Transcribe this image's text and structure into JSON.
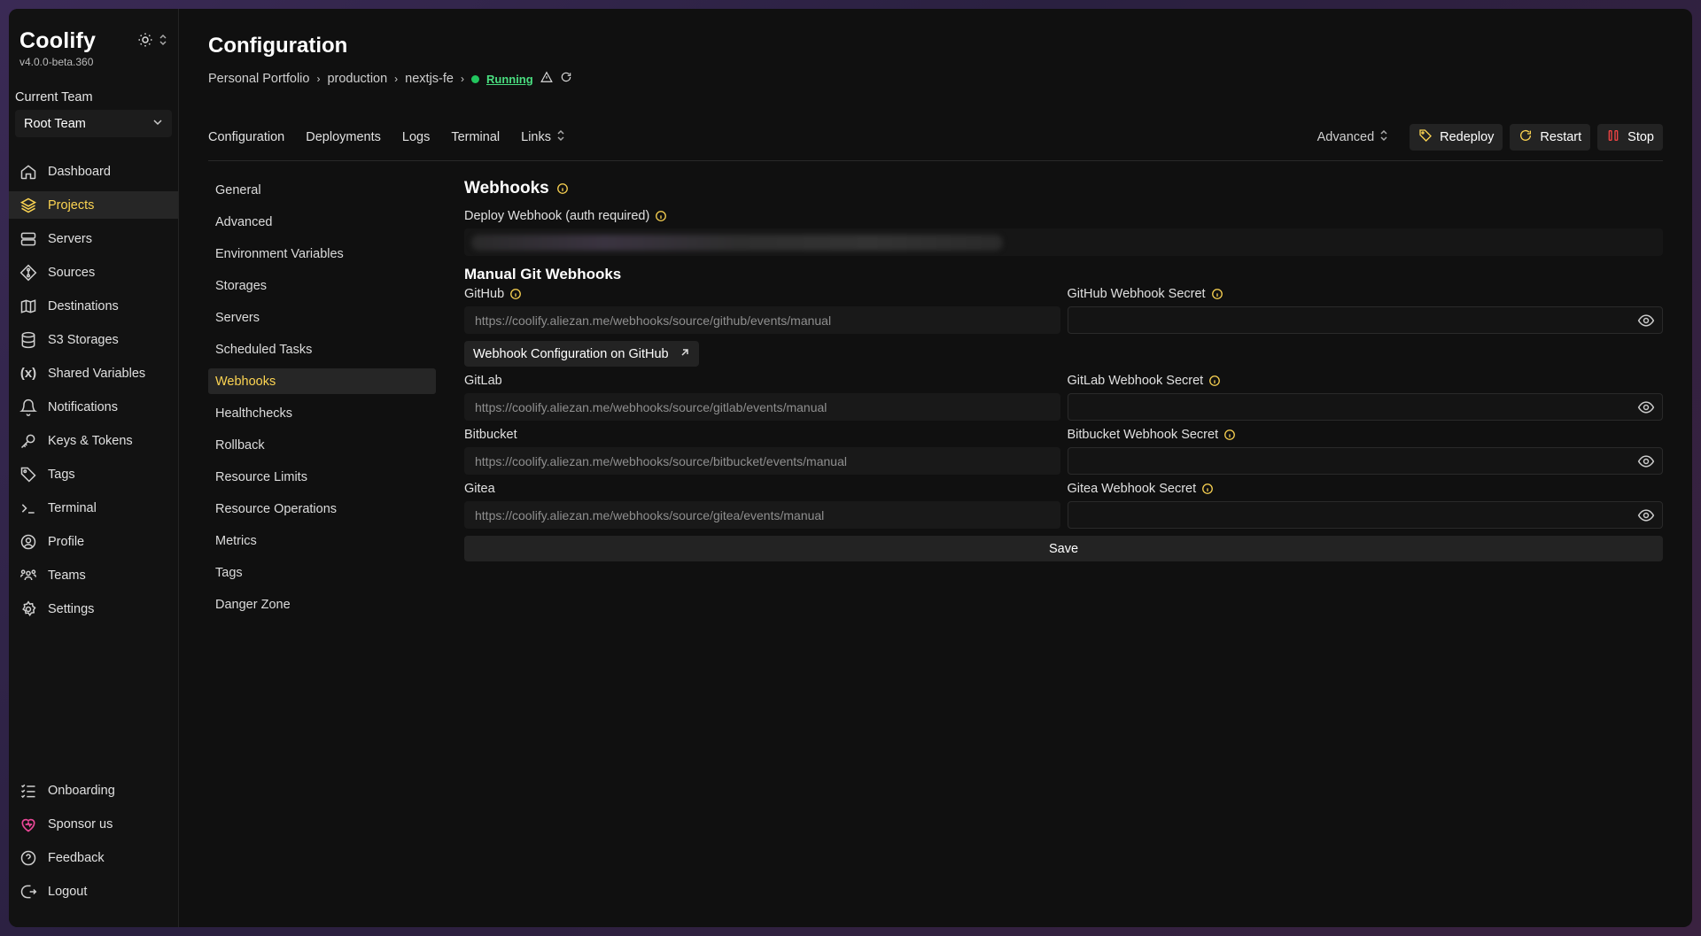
{
  "app": {
    "name": "Coolify",
    "version": "v4.0.0-beta.360"
  },
  "team": {
    "label": "Current Team",
    "selected": "Root Team"
  },
  "nav": {
    "items": [
      {
        "label": "Dashboard",
        "icon": "home-icon"
      },
      {
        "label": "Projects",
        "icon": "layers-icon",
        "active": true
      },
      {
        "label": "Servers",
        "icon": "server-icon"
      },
      {
        "label": "Sources",
        "icon": "git-icon"
      },
      {
        "label": "Destinations",
        "icon": "destination-icon"
      },
      {
        "label": "S3 Storages",
        "icon": "database-icon"
      },
      {
        "label": "Shared Variables",
        "icon": "variable-icon"
      },
      {
        "label": "Notifications",
        "icon": "bell-icon"
      },
      {
        "label": "Keys & Tokens",
        "icon": "key-icon"
      },
      {
        "label": "Tags",
        "icon": "tag-icon"
      },
      {
        "label": "Terminal",
        "icon": "terminal-icon"
      },
      {
        "label": "Profile",
        "icon": "user-icon"
      },
      {
        "label": "Teams",
        "icon": "users-icon"
      },
      {
        "label": "Settings",
        "icon": "gear-icon"
      }
    ],
    "bottom": [
      {
        "label": "Onboarding",
        "icon": "checklist-icon"
      },
      {
        "label": "Sponsor us",
        "icon": "heart-icon"
      },
      {
        "label": "Feedback",
        "icon": "help-icon"
      },
      {
        "label": "Logout",
        "icon": "logout-icon"
      }
    ]
  },
  "header": {
    "title": "Configuration",
    "breadcrumb": [
      "Personal Portfolio",
      "production",
      "nextjs-fe"
    ],
    "status": "Running",
    "status_color": "#4ade80"
  },
  "tabs": [
    "Configuration",
    "Deployments",
    "Logs",
    "Terminal",
    "Links"
  ],
  "actions": {
    "advanced": "Advanced",
    "redeploy": "Redeploy",
    "restart": "Restart",
    "stop": "Stop"
  },
  "subnav": [
    "General",
    "Advanced",
    "Environment Variables",
    "Storages",
    "Servers",
    "Scheduled Tasks",
    "Webhooks",
    "Healthchecks",
    "Rollback",
    "Resource Limits",
    "Resource Operations",
    "Metrics",
    "Tags",
    "Danger Zone"
  ],
  "subnav_active": "Webhooks",
  "webhooks": {
    "title": "Webhooks",
    "deploy_label": "Deploy Webhook (auth required)",
    "manual_title": "Manual Git Webhooks",
    "github": {
      "label": "GitHub",
      "url": "https://coolify.aliezan.me/webhooks/source/github/events/manual",
      "secret_label": "GitHub Webhook Secret"
    },
    "github_button": "Webhook Configuration on GitHub",
    "gitlab": {
      "label": "GitLab",
      "url": "https://coolify.aliezan.me/webhooks/source/gitlab/events/manual",
      "secret_label": "GitLab Webhook Secret"
    },
    "bitbucket": {
      "label": "Bitbucket",
      "url": "https://coolify.aliezan.me/webhooks/source/bitbucket/events/manual",
      "secret_label": "Bitbucket Webhook Secret"
    },
    "gitea": {
      "label": "Gitea",
      "url": "https://coolify.aliezan.me/webhooks/source/gitea/events/manual",
      "secret_label": "Gitea Webhook Secret"
    },
    "save": "Save"
  },
  "colors": {
    "accent": "#fcd452",
    "stop": "#ef4444",
    "running": "#22c55e"
  }
}
